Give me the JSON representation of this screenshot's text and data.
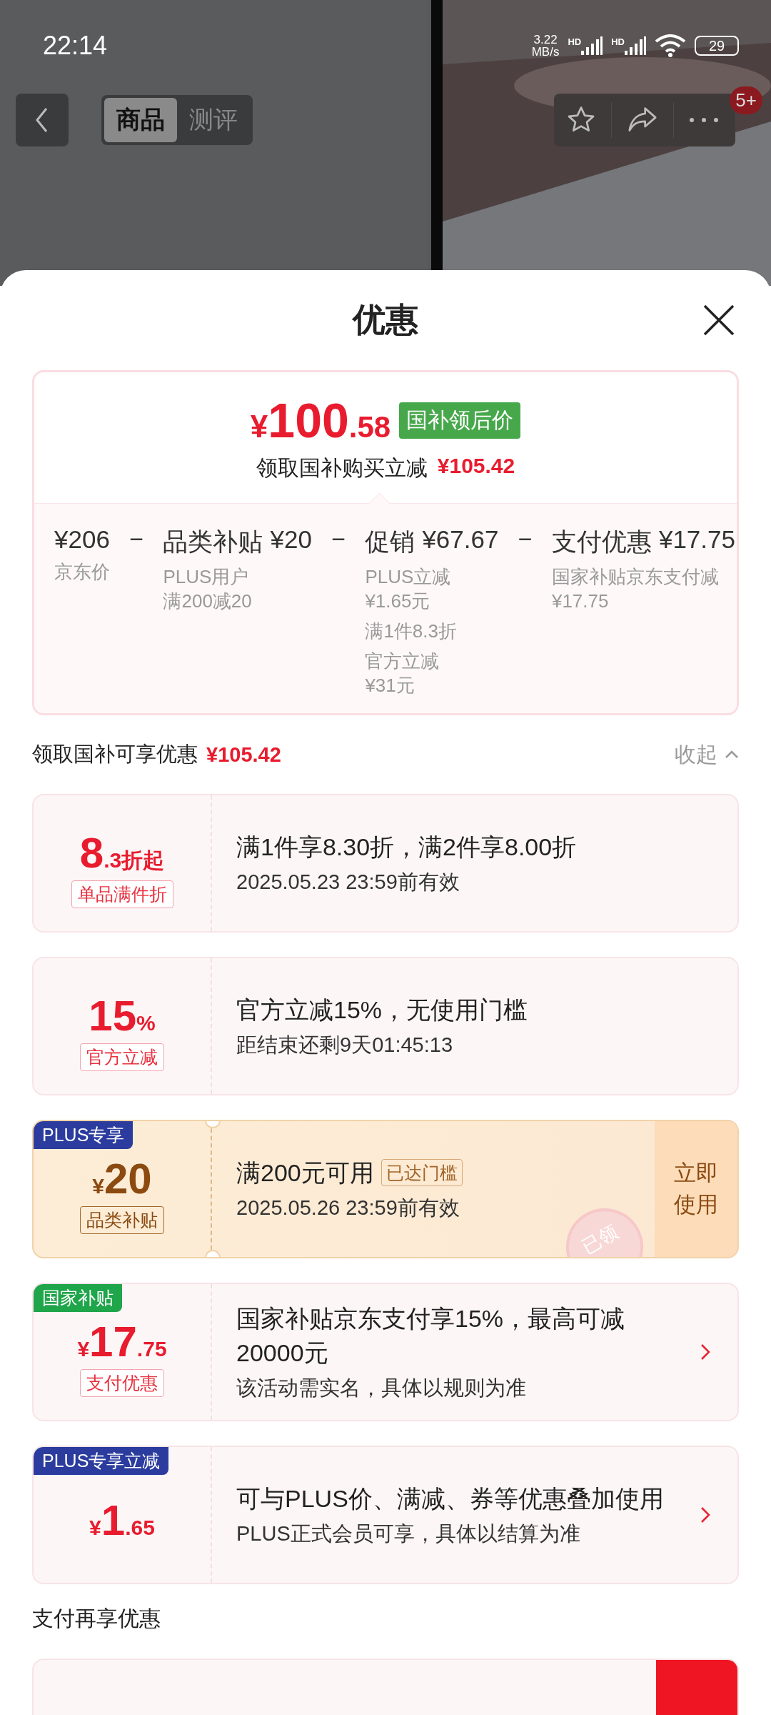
{
  "status_bar": {
    "time": "22:14",
    "speed_value": "3.22",
    "speed_unit": "MB/s",
    "signal_labels": [
      "HD",
      "HD"
    ],
    "battery": "29"
  },
  "nav": {
    "tabs": [
      {
        "label": "商品",
        "selected": true
      },
      {
        "label": "测评",
        "selected": false
      }
    ],
    "badge": "5+"
  },
  "sheet": {
    "title": "优惠"
  },
  "price_card": {
    "currency": "¥",
    "integer": "100",
    "decimal": ".58",
    "tag": "国补领后价",
    "subtitle": "领取国补购买立减",
    "saving": "¥105.42",
    "breakdown": [
      {
        "amount": "¥206",
        "note_groups": [
          [
            "京东价"
          ]
        ]
      },
      {
        "operator": "−",
        "label": "品类补贴",
        "amount": "¥20",
        "note_groups": [
          [
            "PLUS用户",
            "满200减20"
          ]
        ]
      },
      {
        "operator": "−",
        "label": "促销",
        "amount": "¥67.67",
        "note_groups": [
          [
            "PLUS立减",
            "¥1.65元"
          ],
          [
            "满1件8.3折"
          ],
          [
            "官方立减",
            "¥31元"
          ]
        ]
      },
      {
        "operator": "−",
        "label": "支付优惠",
        "amount": "¥17.75",
        "note_groups": [
          [
            "国家补贴京东支付减",
            "¥17.75"
          ]
        ]
      }
    ]
  },
  "section": {
    "title": "领取国补可享优惠",
    "amount": "¥105.42",
    "toggle": "收起"
  },
  "coupons": [
    {
      "kind": "plain",
      "main": "8",
      "suffix": ".3折起",
      "type_label": "单品满件折",
      "title": "满1件享8.30折，满2件享8.00折",
      "subtitle": "2025.05.23 23:59前有效"
    },
    {
      "kind": "plain",
      "main": "15",
      "suffix": "%",
      "type_label": "官方立减",
      "title": "官方立减15%，无使用门槛",
      "subtitle": "距结束还剩9天01:45:13"
    },
    {
      "kind": "gold",
      "corner_tag": {
        "text": "PLUS专享",
        "color": "#2b3c9e"
      },
      "prefix": "¥",
      "main": "20",
      "type_label": "品类补贴",
      "title": "满200元可用",
      "title_tag": "已达门槛",
      "subtitle": "2025.05.26 23:59前有效",
      "action": "立即使用",
      "stamp": "已领"
    },
    {
      "kind": "plain",
      "corner_tag": {
        "text": "国家补贴",
        "color": "#1fa54a"
      },
      "prefix": "¥",
      "main": "17",
      "suffix": ".75",
      "type_label": "支付优惠",
      "title": "国家补贴京东支付享15%，最高可减20000元",
      "subtitle": "该活动需实名，具体以规则为准",
      "arrow": true
    },
    {
      "kind": "plain",
      "corner_tag": {
        "text": "PLUS专享立减",
        "color": "#2b3c9e"
      },
      "prefix": "¥",
      "main": "1",
      "suffix": ".65",
      "title": "可与PLUS价、满减、券等优惠叠加使用",
      "subtitle": "PLUS正式会员可享，具体以结算为准",
      "arrow": true
    }
  ],
  "section2": {
    "title": "支付再享优惠"
  }
}
